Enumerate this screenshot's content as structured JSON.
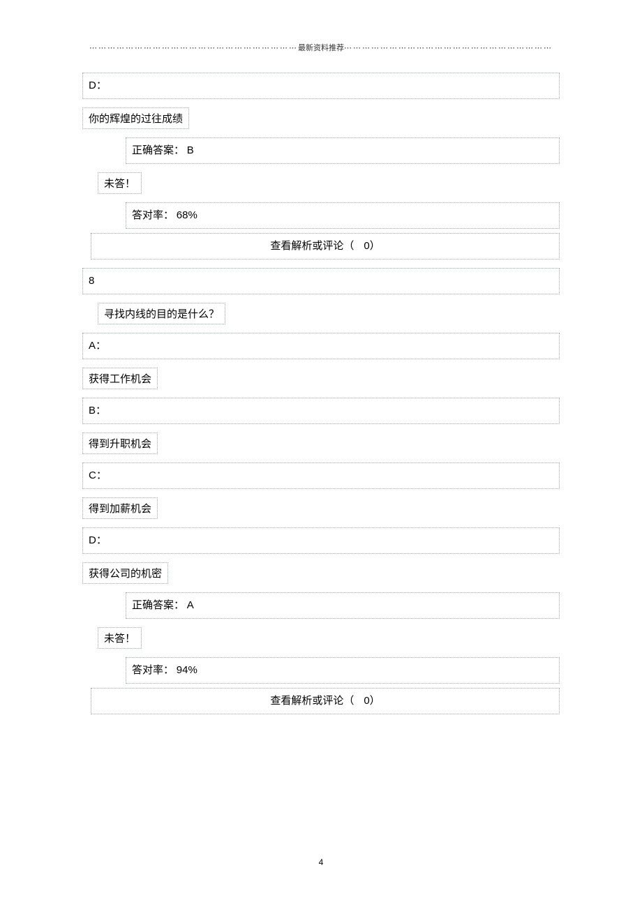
{
  "header": {
    "text": "最新资料推荐"
  },
  "q7": {
    "label_d": "D：",
    "text_d": "你的辉煌的过往成绩",
    "correct_label": "正确答案：",
    "correct_value": "B",
    "unanswered": "未答！",
    "rate_label": "答对率：",
    "rate_value": "68%",
    "comments_label": "查看解析或评论（",
    "comments_count": "0",
    "comments_suffix": "）"
  },
  "q8": {
    "number": "8",
    "question": "寻找内线的目的是什么？",
    "label_a": "A：",
    "text_a": "获得工作机会",
    "label_b": "B：",
    "text_b": "得到升职机会",
    "label_c": "C：",
    "text_c": "得到加薪机会",
    "label_d": "D：",
    "text_d": "获得公司的机密",
    "correct_label": "正确答案：",
    "correct_value": "A",
    "unanswered": "未答！",
    "rate_label": "答对率：",
    "rate_value": "94%",
    "comments_label": "查看解析或评论（",
    "comments_count": "0",
    "comments_suffix": "）"
  },
  "page_number": "4"
}
